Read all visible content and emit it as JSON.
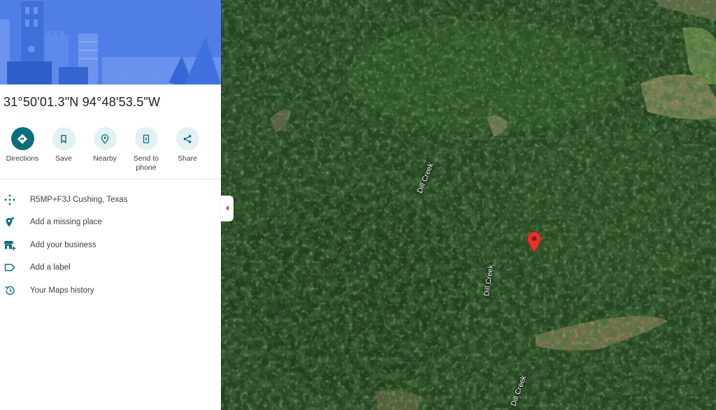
{
  "place": {
    "coordinates": "31°50'01.3\"N 94°48'53.5\"W"
  },
  "actions": [
    {
      "label": "Directions",
      "icon": "directions-icon"
    },
    {
      "label": "Save",
      "icon": "bookmark-icon"
    },
    {
      "label": "Nearby",
      "icon": "nearby-icon"
    },
    {
      "label": "Send to\nphone",
      "icon": "send-to-phone-icon"
    },
    {
      "label": "Share",
      "icon": "share-icon"
    }
  ],
  "info_rows": [
    {
      "text": "R5MP+F3J Cushing, Texas",
      "icon": "plus-code-icon"
    },
    {
      "text": "Add a missing place",
      "icon": "add-place-icon"
    },
    {
      "text": "Add your business",
      "icon": "add-business-icon"
    },
    {
      "text": "Add a label",
      "icon": "label-icon"
    },
    {
      "text": "Your Maps history",
      "icon": "history-icon"
    }
  ],
  "map": {
    "labels": [
      "Dill Creek",
      "Dill Creek",
      "Dill Creek"
    ]
  },
  "colors": {
    "accent": "#0b6e7a",
    "hero_bg": "#4f7fe6",
    "pin": "#e5322d",
    "forest": "#1f3d1c"
  }
}
